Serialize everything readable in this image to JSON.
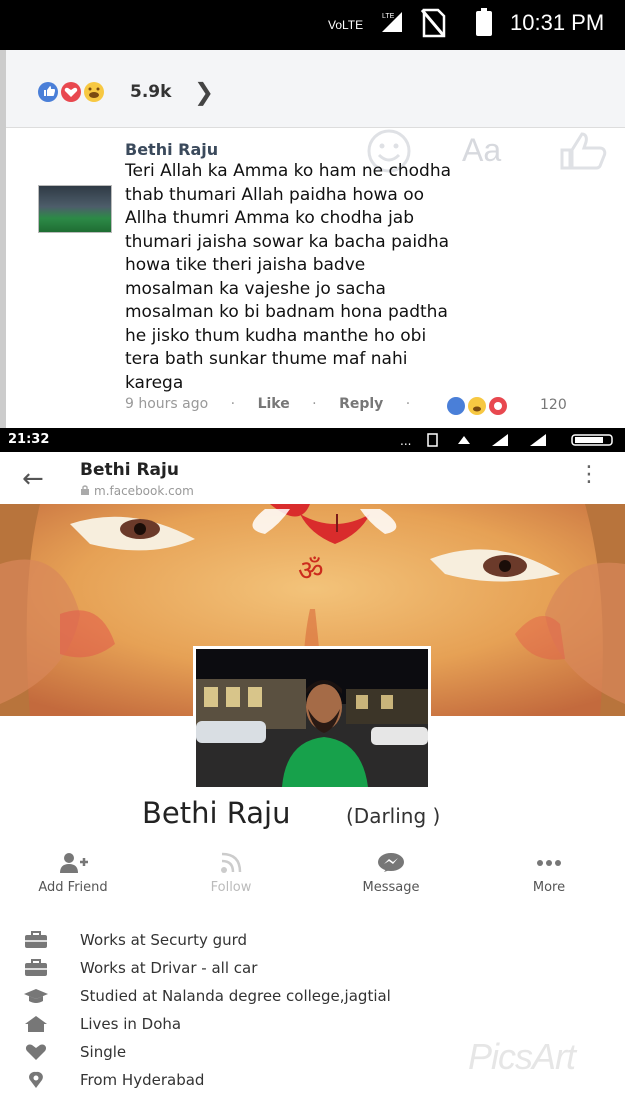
{
  "status_bar_top": {
    "network": "VoLTE",
    "lte_badge": "LTE",
    "time": "10:31 PM"
  },
  "comment_panel": {
    "reaction_count": "5.9k",
    "composer_placeholder": "Aa",
    "comment": {
      "author": "Bethi Raju",
      "lines": [
        "Teri Allah ka Amma ko ham ne chodha",
        "thab thumari  Allah paidha howa oo",
        "Allha  thumri Amma ko  chodha  jab",
        "thumari jaisha  sowar ka bacha paidha",
        "howa tike theri jaisha badve",
        "mosalman ka  vajeshe jo sacha",
        "mosalman ko bi badnam hona padtha",
        "he jisko thum kudha manthe ho obi",
        "tera bath sunkar thume maf nahi",
        "karega"
      ],
      "time_ago": "9 hours ago",
      "like_label": "Like",
      "reply_label": "Reply",
      "reaction_count": "120"
    }
  },
  "status_bar_second": {
    "time": "21:32"
  },
  "profile": {
    "header_name": "Bethi Raju",
    "url": "m.facebook.com",
    "name": "Bethi Raju",
    "nickname": "(Darling )",
    "actions": [
      {
        "label": "Add Friend",
        "icon": "add-friend-icon"
      },
      {
        "label": "Follow",
        "icon": "rss-icon"
      },
      {
        "label": "Message",
        "icon": "messenger-icon"
      },
      {
        "label": "More",
        "icon": "more-dots-icon"
      }
    ],
    "info": [
      {
        "text": "Works at Securty gurd",
        "icon": "briefcase-icon"
      },
      {
        "text": "Works at Drivar - all car",
        "icon": "briefcase-icon"
      },
      {
        "text": "Studied at Nalanda degree college,jagtial",
        "icon": "graduation-cap-icon"
      },
      {
        "text": "Lives in Doha",
        "icon": "home-icon"
      },
      {
        "text": "Single",
        "icon": "heart-icon"
      },
      {
        "text": "From Hyderabad",
        "icon": "location-pin-icon"
      }
    ]
  },
  "watermark": "PicsArt",
  "colors": {
    "like_blue": "#4a7fd8",
    "haha_yellow": "#f7c842",
    "love_red": "#e8484f",
    "status_bar": "#000000"
  }
}
